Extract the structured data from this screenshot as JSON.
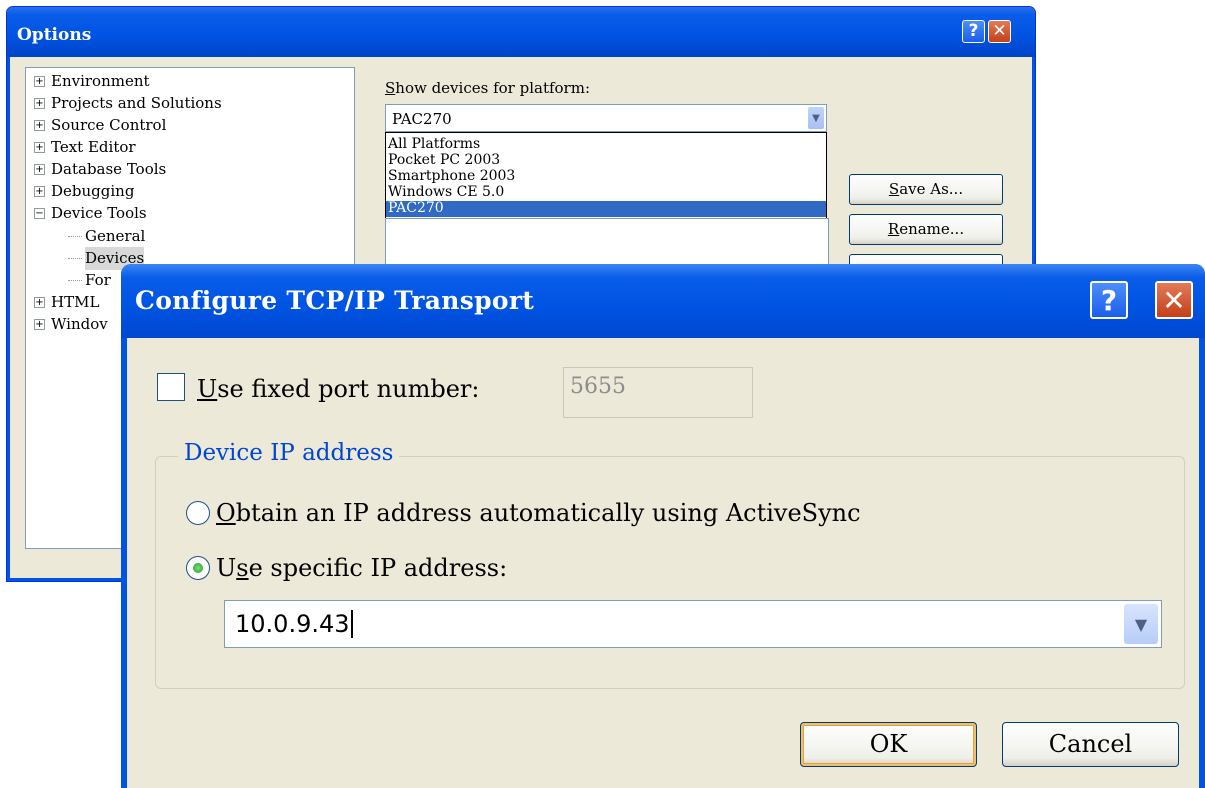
{
  "options": {
    "title": "Options",
    "tree": [
      {
        "label": "Environment",
        "expander": "+"
      },
      {
        "label": "Projects and Solutions",
        "expander": "+"
      },
      {
        "label": "Source Control",
        "expander": "+"
      },
      {
        "label": "Text Editor",
        "expander": "+"
      },
      {
        "label": "Database Tools",
        "expander": "+"
      },
      {
        "label": "Debugging",
        "expander": "+"
      },
      {
        "label": "Device Tools",
        "expander": "−"
      },
      {
        "label": "General"
      },
      {
        "label": "Devices"
      },
      {
        "label": "For"
      },
      {
        "label": "HTML",
        "expander": "+"
      },
      {
        "label": "Windov",
        "expander": "+"
      }
    ],
    "platform_label_pre": "S",
    "platform_label_rest": "how devices for platform:",
    "platform_value": "PAC270",
    "platform_options": [
      "All Platforms",
      "Pocket PC 2003",
      "Smartphone 2003",
      "Windows CE 5.0",
      "PAC270"
    ],
    "save_as_pre": "S",
    "save_as_rest": "ave As...",
    "rename_pre": "R",
    "rename_rest": "ename..."
  },
  "tcp": {
    "title": "Configure TCP/IP Transport",
    "fixed_port_pre": "U",
    "fixed_port_rest": "se fixed port number:",
    "fixed_port_checked": false,
    "port_value": "5655",
    "group_title": "Device IP address",
    "radio_auto_pre": "O",
    "radio_auto_rest": "btain an IP address automatically using ActiveSync",
    "radio_specific_a": "U",
    "radio_specific_b": "s",
    "radio_specific_c": "e specific IP address:",
    "selected_radio": "specific",
    "ip_value": "10.0.9.43",
    "ok_label": "OK",
    "cancel_label": "Cancel"
  }
}
